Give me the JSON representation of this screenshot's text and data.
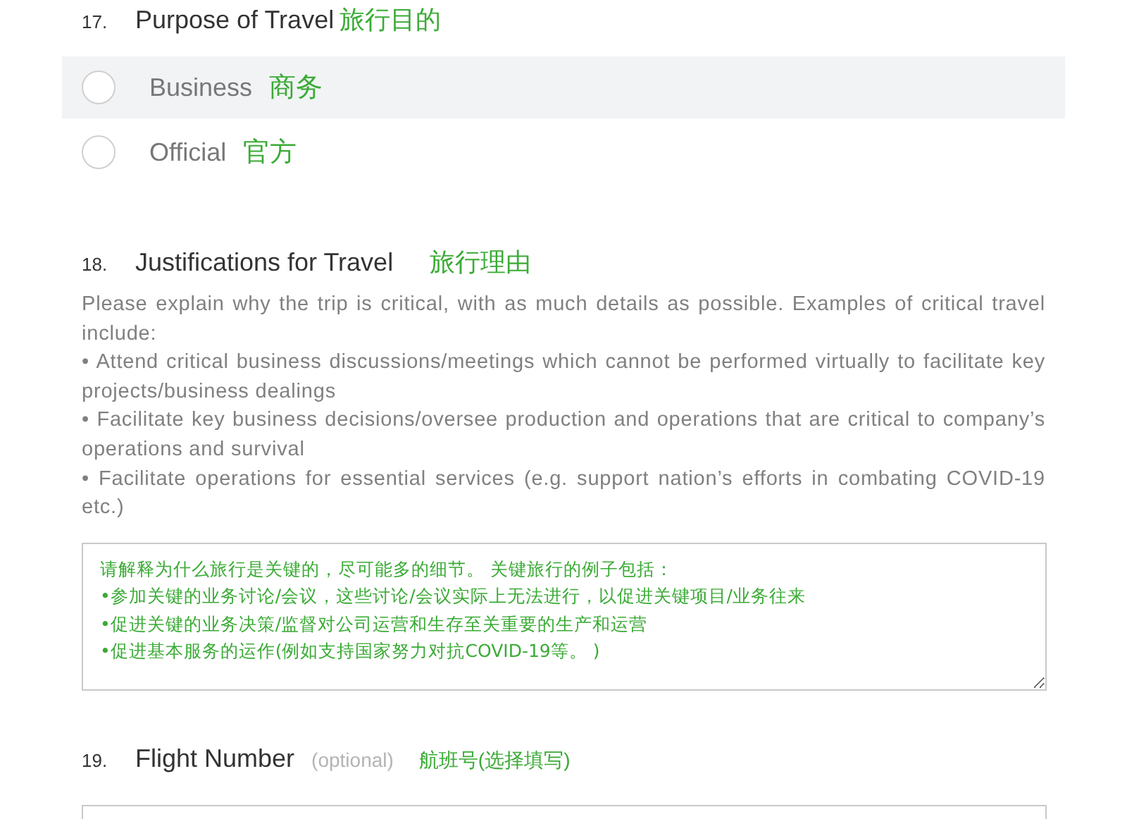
{
  "questions": [
    {
      "number": "17.",
      "title": "Purpose of Travel",
      "translation": "旅行目的",
      "kind": "radio",
      "options": [
        {
          "label": "Business",
          "translation": "商务",
          "selected": false,
          "hovered": true
        },
        {
          "label": "Official",
          "translation": "官方",
          "selected": false,
          "hovered": false
        }
      ]
    },
    {
      "number": "18.",
      "title": "Justifications for Travel",
      "translation": "旅行理由",
      "kind": "textarea",
      "description": [
        "Please explain why the trip is critical, with as much details as possible. Examples of critical travel include:",
        "• Attend critical business discussions/meetings which cannot be performed virtually to facilitate key projects/business dealings",
        "• Facilitate key business decisions/oversee production and operations that are critical to company’s operations and survival",
        "• Facilitate operations for essential services (e.g. support nation’s efforts in combating COVID-19 etc.)"
      ],
      "value": "请解释为什么旅行是关键的，尽可能多的细节。 关键旅行的例子包括：\n•参加关键的业务讨论/会议，这些讨论/会议实际上无法进行，以促进关键项目/业务往来\n•促进关键的业务决策/监督对公司运营和生存至关重要的生产和运营\n•促进基本服务的运作(例如支持国家努力对抗COVID-19等。 )"
    },
    {
      "number": "19.",
      "title": "Flight Number",
      "optional": "(optional)",
      "translation": "航班号(选择填写)",
      "kind": "text"
    }
  ]
}
